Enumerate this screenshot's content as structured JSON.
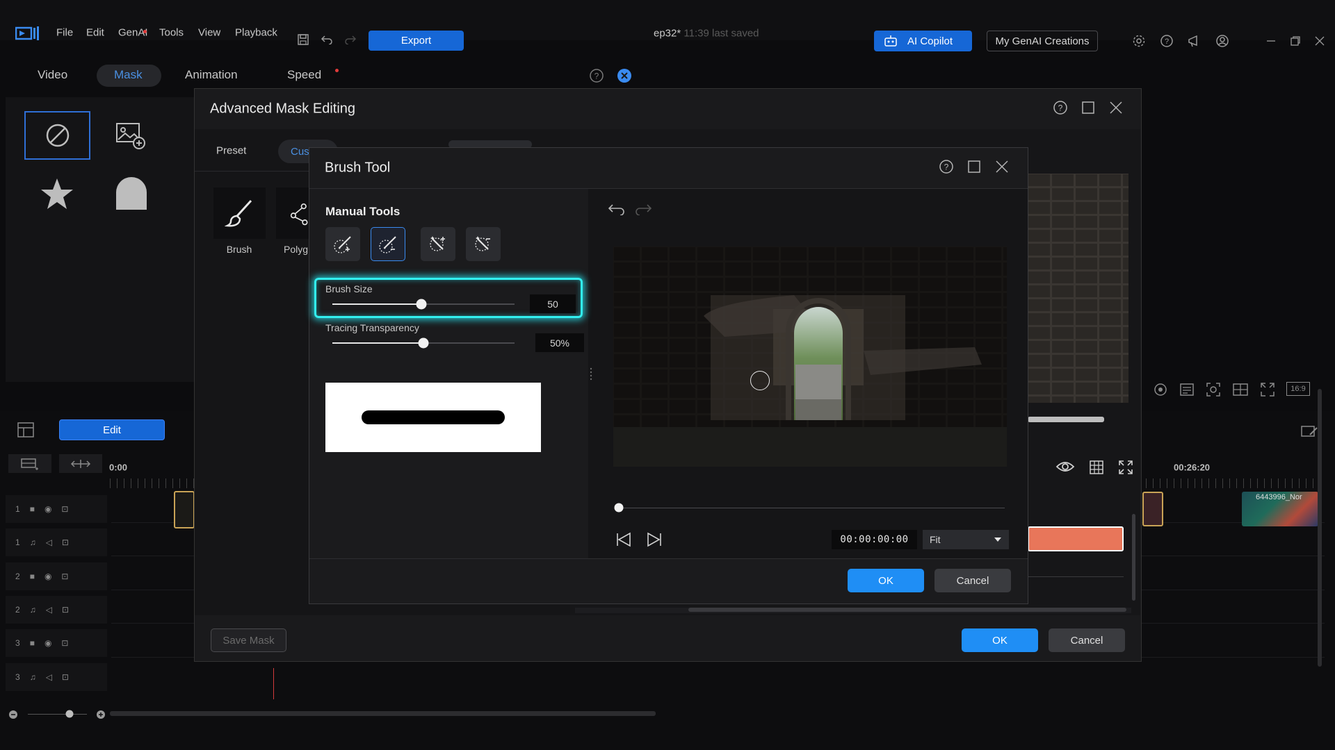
{
  "menu": {
    "file": "File",
    "edit": "Edit",
    "genai": "GenAI",
    "tools": "Tools",
    "view": "View",
    "playback": "Playback",
    "export": "Export"
  },
  "project": {
    "name": "ep32*",
    "saved": "11:39 last saved"
  },
  "header_right": {
    "copilot": "AI Copilot",
    "genai_creations": "My GenAI Creations"
  },
  "tabs": {
    "video": "Video",
    "mask": "Mask",
    "animation": "Animation",
    "speed": "Speed"
  },
  "timeline": {
    "edit": "Edit",
    "start_time": "0:00",
    "mid_time": "00:26:20",
    "clip_name": "6443996_Nor",
    "tracks": [
      {
        "num": "1",
        "type": "video"
      },
      {
        "num": "1",
        "type": "audio"
      },
      {
        "num": "2",
        "type": "video"
      },
      {
        "num": "2",
        "type": "audio"
      },
      {
        "num": "3",
        "type": "video"
      },
      {
        "num": "3",
        "type": "audio"
      }
    ]
  },
  "preview_right": {
    "aspect": "16:9"
  },
  "mask_editor": {
    "title": "Advanced Mask Editing",
    "preset": "Preset",
    "custom": "Cus",
    "brush": "Brush",
    "polygon": "Polyg",
    "save_mask": "Save Mask",
    "ok": "OK",
    "cancel": "Cancel"
  },
  "brush_tool": {
    "title": "Brush Tool",
    "manual_tools": "Manual Tools",
    "brush_size_label": "Brush Size",
    "brush_size_value": "50",
    "brush_size_fraction": 0.49,
    "tracing_label": "Tracing Transparency",
    "tracing_value": "50%",
    "tracing_fraction": 0.5,
    "timecode": "00:00:00:00",
    "zoom": "Fit",
    "playhead_fraction": 0,
    "ok": "OK",
    "cancel": "Cancel"
  },
  "colors": {
    "accent": "#1f8ef5",
    "highlight": "#32f0f0",
    "clip_audio": "#e8765a"
  }
}
